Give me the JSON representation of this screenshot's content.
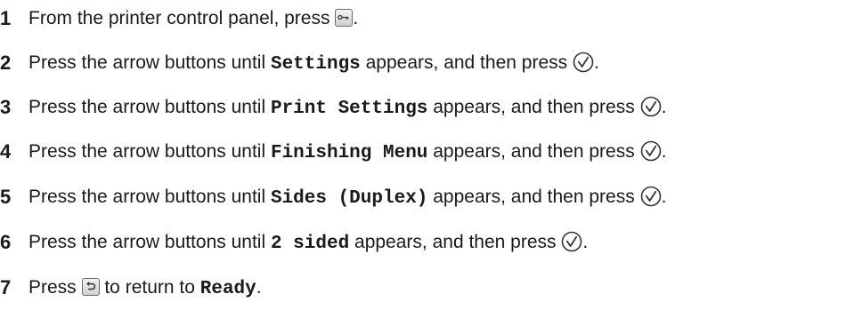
{
  "steps": [
    {
      "number": "1",
      "segments": [
        {
          "type": "text",
          "value": "From the printer control panel, press "
        },
        {
          "type": "icon",
          "icon": "key-icon"
        },
        {
          "type": "text",
          "value": "."
        }
      ]
    },
    {
      "number": "2",
      "segments": [
        {
          "type": "text",
          "value": "Press the arrow buttons until "
        },
        {
          "type": "mono",
          "value": "Settings"
        },
        {
          "type": "text",
          "value": " appears, and then press "
        },
        {
          "type": "icon",
          "icon": "select-check-icon"
        },
        {
          "type": "text",
          "value": "."
        }
      ]
    },
    {
      "number": "3",
      "segments": [
        {
          "type": "text",
          "value": "Press the arrow buttons until "
        },
        {
          "type": "mono",
          "value": "Print Settings"
        },
        {
          "type": "text",
          "value": " appears, and then press "
        },
        {
          "type": "icon",
          "icon": "select-check-icon"
        },
        {
          "type": "text",
          "value": "."
        }
      ]
    },
    {
      "number": "4",
      "segments": [
        {
          "type": "text",
          "value": "Press the arrow buttons until "
        },
        {
          "type": "mono",
          "value": "Finishing Menu"
        },
        {
          "type": "text",
          "value": " appears, and then press "
        },
        {
          "type": "icon",
          "icon": "select-check-icon"
        },
        {
          "type": "text",
          "value": "."
        }
      ]
    },
    {
      "number": "5",
      "segments": [
        {
          "type": "text",
          "value": "Press the arrow buttons until "
        },
        {
          "type": "mono",
          "value": "Sides (Duplex)"
        },
        {
          "type": "text",
          "value": " appears, and then press "
        },
        {
          "type": "icon",
          "icon": "select-check-icon"
        },
        {
          "type": "text",
          "value": "."
        }
      ]
    },
    {
      "number": "6",
      "segments": [
        {
          "type": "text",
          "value": "Press the arrow buttons until "
        },
        {
          "type": "mono",
          "value": "2 sided"
        },
        {
          "type": "text",
          "value": " appears, and then press "
        },
        {
          "type": "icon",
          "icon": "select-check-icon"
        },
        {
          "type": "text",
          "value": "."
        }
      ]
    },
    {
      "number": "7",
      "segments": [
        {
          "type": "text",
          "value": "Press "
        },
        {
          "type": "icon",
          "icon": "back-icon"
        },
        {
          "type": "text",
          "value": " to return to "
        },
        {
          "type": "mono",
          "value": "Ready"
        },
        {
          "type": "text",
          "value": "."
        }
      ]
    }
  ]
}
